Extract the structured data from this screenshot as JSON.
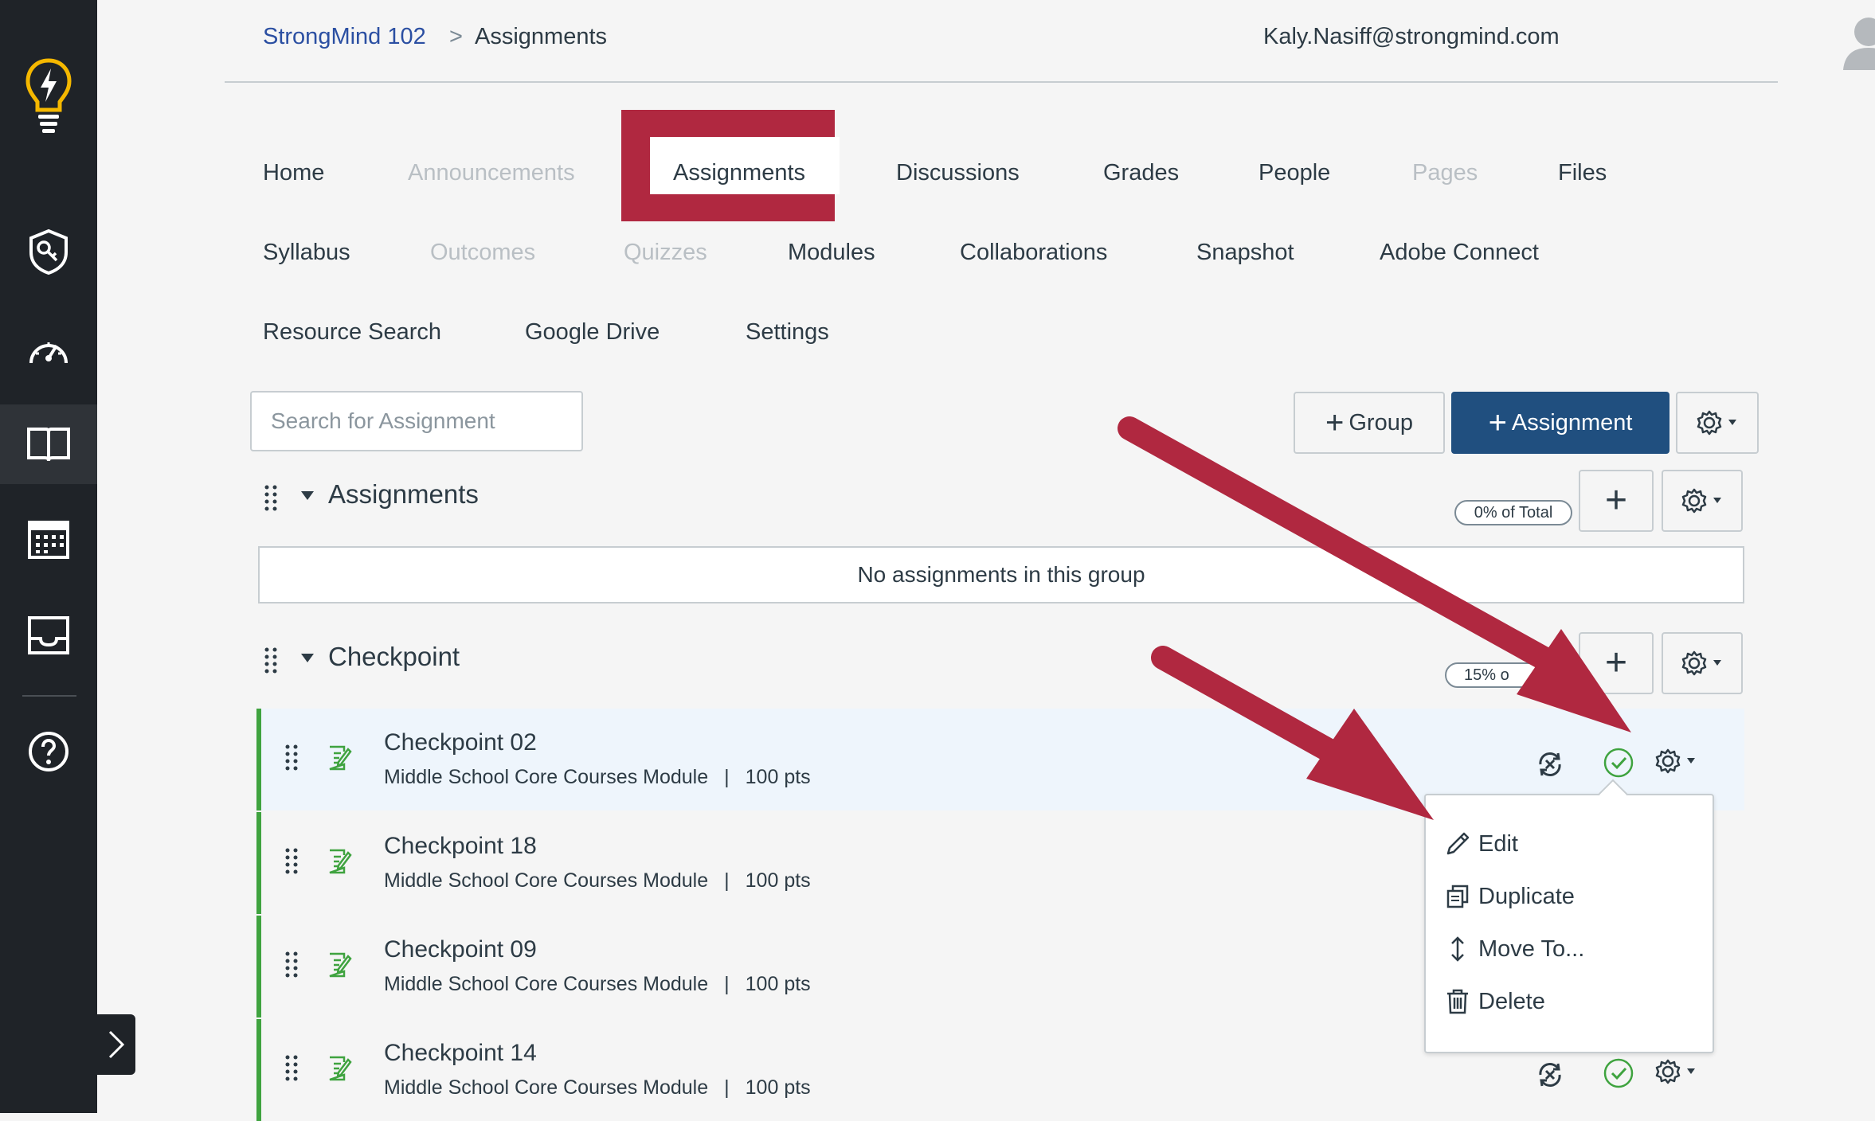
{
  "breadcrumb": {
    "course": "StrongMind 102",
    "separator": ">",
    "current": "Assignments"
  },
  "user": {
    "email": "Kaly.Nasiff@strongmind.com"
  },
  "nav": [
    {
      "label": "Home",
      "disabled": false
    },
    {
      "label": "Announcements",
      "disabled": true
    },
    {
      "label": "Assignments",
      "disabled": false,
      "active": true
    },
    {
      "label": "Discussions",
      "disabled": false
    },
    {
      "label": "Grades",
      "disabled": false
    },
    {
      "label": "People",
      "disabled": false
    },
    {
      "label": "Pages",
      "disabled": true
    },
    {
      "label": "Files",
      "disabled": false
    },
    {
      "label": "Syllabus",
      "disabled": false
    },
    {
      "label": "Outcomes",
      "disabled": true
    },
    {
      "label": "Quizzes",
      "disabled": true
    },
    {
      "label": "Modules",
      "disabled": false
    },
    {
      "label": "Collaborations",
      "disabled": false
    },
    {
      "label": "Snapshot",
      "disabled": false
    },
    {
      "label": "Adobe Connect",
      "disabled": false
    },
    {
      "label": "Resource Search",
      "disabled": false
    },
    {
      "label": "Google Drive",
      "disabled": false
    },
    {
      "label": "Settings",
      "disabled": false
    }
  ],
  "toolbar": {
    "search_placeholder": "Search for Assignment",
    "group_label": "Group",
    "assignment_label": "Assignment"
  },
  "groups": [
    {
      "title": "Assignments",
      "percent": "0% of Total",
      "empty_text": "No assignments in this group"
    },
    {
      "title": "Checkpoint",
      "percent": "15% o"
    }
  ],
  "items": [
    {
      "title": "Checkpoint 02",
      "module": "Middle School Core Courses Module",
      "sep": "|",
      "points": "100 pts"
    },
    {
      "title": "Checkpoint 18",
      "module": "Middle School Core Courses Module",
      "sep": "|",
      "points": "100 pts"
    },
    {
      "title": "Checkpoint 09",
      "module": "Middle School Core Courses Module",
      "sep": "|",
      "points": "100 pts"
    },
    {
      "title": "Checkpoint 14",
      "module": "Middle School Core Courses Module",
      "sep": "|",
      "points": "100 pts"
    }
  ],
  "menu": {
    "edit": "Edit",
    "duplicate": "Duplicate",
    "move": "Move To...",
    "delete": "Delete"
  },
  "colors": {
    "sidebar": "#1f2328",
    "link": "#2b4fa2",
    "primary": "#204f7f",
    "highlight": "#b02840",
    "published": "#3fa33f",
    "logo": "#f5b800"
  },
  "icons": [
    "lightbulb-logo-icon",
    "shield-key-icon",
    "dashboard-gauge-icon",
    "courses-book-icon",
    "calendar-icon",
    "inbox-icon",
    "help-icon",
    "chevron-right-icon",
    "gear-icon",
    "plus-icon",
    "drag-handle-icon",
    "assignment-icon",
    "unpublish-sync-icon",
    "published-check-icon",
    "pencil-icon",
    "copy-icon",
    "move-arrows-icon",
    "trash-icon"
  ]
}
